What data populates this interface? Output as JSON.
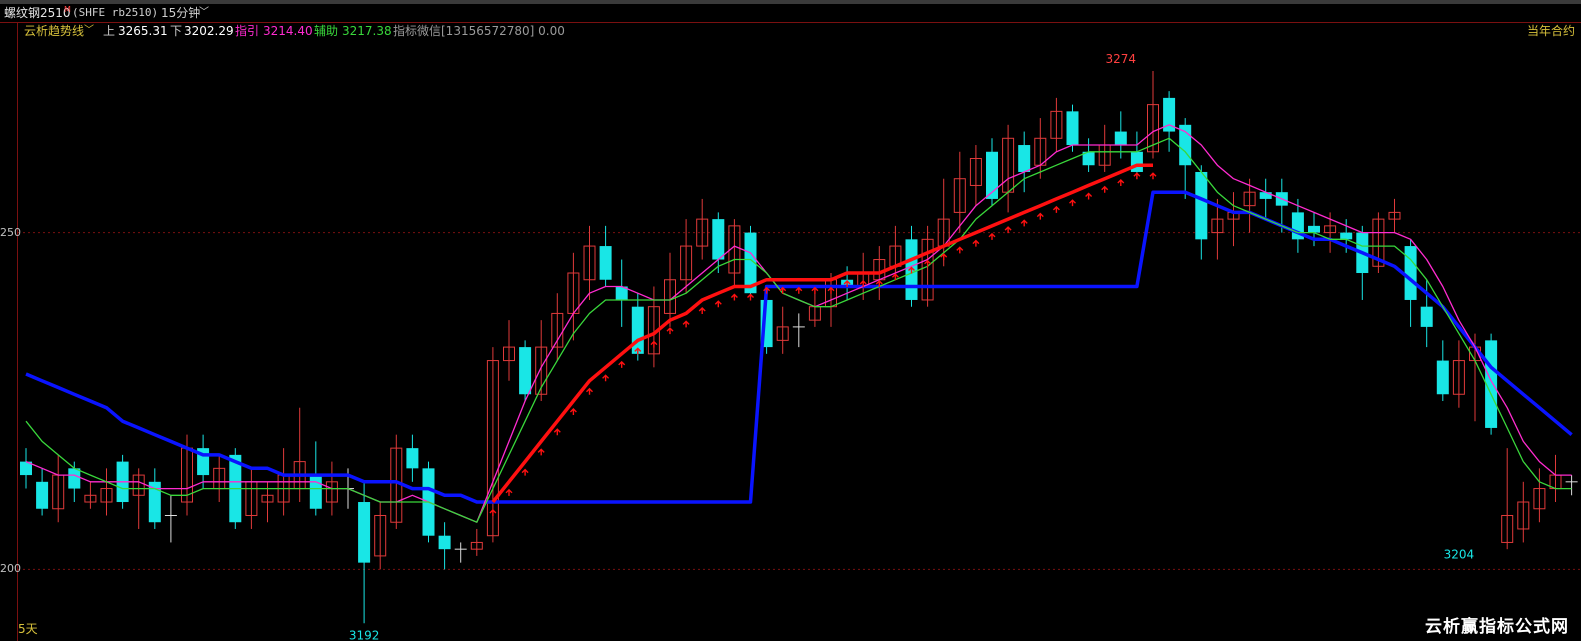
{
  "window": {
    "instrument_name": "螺纹钢2510",
    "instrument_flag": "M",
    "instrument_code": "(SHFE rb2510)",
    "period_label": "15分钟",
    "period_chevron": "﹀",
    "contract_label": "当年合约"
  },
  "indicator": {
    "name": "云析趋势线",
    "chevron": "﹀",
    "upper_key": "上",
    "upper_value": "3265.31",
    "lower_key": "下",
    "lower_value": "3202.29",
    "guide_key": "指引",
    "guide_value": "3214.40",
    "aux_key": "辅助",
    "aux_value": "3217.38",
    "wechat_text": "指标微信[13156572780] 0.00"
  },
  "footer": {
    "days_label": "5天",
    "watermark": "云析赢指标公式网"
  },
  "colors": {
    "up": "#e03a3a",
    "down": "#19e6e6",
    "blue_line": "#0a14ff",
    "red_line": "#ff1010",
    "magenta_line": "#ff2bd0",
    "green_line": "#39d83b",
    "grid": "#7a1010"
  },
  "chart_data": {
    "type": "candlestick",
    "title": "",
    "y_ticks": [
      {
        "value": 3250,
        "label": "250"
      },
      {
        "value": 3200,
        "label": "200"
      }
    ],
    "ylim": [
      3191,
      3278
    ],
    "annotations": [
      {
        "text": "3274",
        "value": 3274,
        "candle": 68
      },
      {
        "text": "3192",
        "value": 3192,
        "candle": 21
      },
      {
        "text": "3204",
        "value": 3204,
        "candle": 89
      }
    ],
    "candles": [
      [
        3216,
        3214,
        3218,
        3212
      ],
      [
        3213,
        3209,
        3215,
        3208
      ],
      [
        3209,
        3214,
        3217,
        3207
      ],
      [
        3215,
        3212,
        3216,
        3210
      ],
      [
        3210,
        3211,
        3213,
        3209
      ],
      [
        3210,
        3212,
        3215,
        3208
      ],
      [
        3216,
        3210,
        3217,
        3209
      ],
      [
        3211,
        3214,
        3215,
        3206
      ],
      [
        3213,
        3207,
        3215,
        3206
      ],
      [
        3208,
        3208,
        3211,
        3204
      ],
      [
        3210,
        3218,
        3220,
        3208
      ],
      [
        3218,
        3214,
        3220,
        3212
      ],
      [
        3212,
        3215,
        3217,
        3210
      ],
      [
        3217,
        3207,
        3218,
        3206
      ],
      [
        3208,
        3213,
        3215,
        3206
      ],
      [
        3210,
        3211,
        3213,
        3207
      ],
      [
        3210,
        3214,
        3218,
        3208
      ],
      [
        3212,
        3216,
        3224,
        3210
      ],
      [
        3214,
        3209,
        3219,
        3208
      ],
      [
        3210,
        3213,
        3216,
        3208
      ],
      [
        3212,
        3212,
        3215,
        3209
      ],
      [
        3210,
        3201,
        3213,
        3192
      ],
      [
        3202,
        3208,
        3210,
        3200
      ],
      [
        3207,
        3218,
        3220,
        3206
      ],
      [
        3218,
        3215,
        3220,
        3213
      ],
      [
        3215,
        3205,
        3216,
        3204
      ],
      [
        3205,
        3203,
        3207,
        3200
      ],
      [
        3203,
        3203,
        3204,
        3201
      ],
      [
        3203,
        3204,
        3206,
        3202
      ],
      [
        3205,
        3231,
        3233,
        3204
      ],
      [
        3231,
        3233,
        3237,
        3228
      ],
      [
        3233,
        3226,
        3234,
        3225
      ],
      [
        3226,
        3233,
        3237,
        3225
      ],
      [
        3233,
        3238,
        3241,
        3231
      ],
      [
        3238,
        3244,
        3247,
        3234
      ],
      [
        3243,
        3248,
        3251,
        3240
      ],
      [
        3248,
        3243,
        3251,
        3242
      ],
      [
        3242,
        3240,
        3246,
        3236
      ],
      [
        3239,
        3232,
        3241,
        3231
      ],
      [
        3232,
        3239,
        3242,
        3230
      ],
      [
        3238,
        3243,
        3247,
        3236
      ],
      [
        3243,
        3248,
        3252,
        3241
      ],
      [
        3248,
        3252,
        3255,
        3246
      ],
      [
        3252,
        3246,
        3253,
        3244
      ],
      [
        3244,
        3251,
        3252,
        3242
      ],
      [
        3250,
        3241,
        3251,
        3240
      ],
      [
        3240,
        3233,
        3242,
        3232
      ],
      [
        3234,
        3236,
        3239,
        3232
      ],
      [
        3236,
        3236,
        3238,
        3233
      ],
      [
        3237,
        3239,
        3241,
        3236
      ],
      [
        3239,
        3243,
        3244,
        3236
      ],
      [
        3243,
        3242,
        3245,
        3240
      ],
      [
        3242,
        3244,
        3247,
        3240
      ],
      [
        3243,
        3246,
        3248,
        3240
      ],
      [
        3245,
        3248,
        3251,
        3243
      ],
      [
        3249,
        3240,
        3251,
        3239
      ],
      [
        3240,
        3249,
        3251,
        3239
      ],
      [
        3248,
        3252,
        3258,
        3245
      ],
      [
        3253,
        3258,
        3262,
        3250
      ],
      [
        3257,
        3261,
        3263,
        3254
      ],
      [
        3262,
        3255,
        3264,
        3254
      ],
      [
        3256,
        3264,
        3266,
        3253
      ],
      [
        3263,
        3259,
        3265,
        3256
      ],
      [
        3260,
        3264,
        3267,
        3258
      ],
      [
        3264,
        3268,
        3270,
        3262
      ],
      [
        3268,
        3263,
        3269,
        3262
      ],
      [
        3262,
        3260,
        3264,
        3259
      ],
      [
        3260,
        3263,
        3266,
        3259
      ],
      [
        3265,
        3263,
        3268,
        3261
      ],
      [
        3262,
        3259,
        3265,
        3258
      ],
      [
        3262,
        3269,
        3274,
        3261
      ],
      [
        3270,
        3265,
        3271,
        3262
      ],
      [
        3266,
        3260,
        3267,
        3255
      ],
      [
        3259,
        3249,
        3260,
        3246
      ],
      [
        3250,
        3252,
        3255,
        3246
      ],
      [
        3252,
        3253,
        3256,
        3248
      ],
      [
        3254,
        3256,
        3258,
        3250
      ],
      [
        3256,
        3255,
        3258,
        3252
      ],
      [
        3256,
        3254,
        3258,
        3250
      ],
      [
        3253,
        3249,
        3255,
        3247
      ],
      [
        3251,
        3250,
        3253,
        3248
      ],
      [
        3250,
        3251,
        3253,
        3247
      ],
      [
        3250,
        3249,
        3252,
        3247
      ],
      [
        3250,
        3244,
        3251,
        3240
      ],
      [
        3245,
        3252,
        3253,
        3244
      ],
      [
        3252,
        3253,
        3255,
        3250
      ],
      [
        3248,
        3240,
        3249,
        3236
      ],
      [
        3239,
        3236,
        3243,
        3233
      ],
      [
        3231,
        3226,
        3234,
        3225
      ],
      [
        3226,
        3231,
        3234,
        3224
      ],
      [
        3231,
        3233,
        3235,
        3222
      ],
      [
        3234,
        3221,
        3235,
        3220
      ],
      [
        3204,
        3208,
        3218,
        3203
      ],
      [
        3206,
        3210,
        3213,
        3204
      ],
      [
        3209,
        3212,
        3215,
        3207
      ],
      [
        3212,
        3214,
        3217,
        3210
      ],
      [
        3213,
        3213,
        3214,
        3211
      ],
      [
        3214,
        3212,
        3215,
        3210
      ],
      [
        3212,
        3213,
        3214,
        3209
      ]
    ],
    "series": [
      {
        "name": "",
        "color": "#0a14ff",
        "values": [
          3229,
          3228,
          3227,
          3226,
          3225,
          3224,
          3222,
          3221,
          3220,
          3219,
          3218,
          3217,
          3217,
          3216,
          3215,
          3215,
          3214,
          3214,
          3214,
          3214,
          3214,
          3213,
          3213,
          3213,
          3212,
          3212,
          3211,
          3211,
          3210,
          3210,
          3210,
          3210,
          3210,
          3210,
          3210,
          3210,
          3210,
          3210,
          3210,
          3210,
          3210,
          3210,
          3210,
          3210,
          3210,
          3210,
          3242,
          3242,
          3242,
          3242,
          3242,
          3242,
          3242,
          3242,
          3242,
          3242,
          3242,
          3242,
          3242,
          3242,
          3242,
          3242,
          3242,
          3242,
          3242,
          3242,
          3242,
          3242,
          3242,
          3242,
          3256,
          3256,
          3256,
          3255,
          3254,
          3253,
          3253,
          3252,
          3251,
          3250,
          3249,
          3249,
          3248,
          3247,
          3246,
          3245,
          3243,
          3241,
          3239,
          3236,
          3233,
          3230,
          3228,
          3226,
          3224,
          3222,
          3220
        ]
      },
      {
        "name": "",
        "color": "#ff2bd0",
        "values": [
          3216,
          3215,
          3214,
          3214,
          3213,
          3213,
          3213,
          3213,
          3212,
          3212,
          3212,
          3213,
          3213,
          3213,
          3213,
          3213,
          3213,
          3213,
          3213,
          3212,
          3212,
          3211,
          3210,
          3210,
          3211,
          3210,
          3209,
          3208,
          3207,
          3213,
          3219,
          3225,
          3230,
          3234,
          3238,
          3241,
          3242,
          3242,
          3241,
          3240,
          3240,
          3242,
          3244,
          3246,
          3248,
          3247,
          3244,
          3241,
          3240,
          3239,
          3240,
          3241,
          3242,
          3243,
          3244,
          3245,
          3246,
          3248,
          3251,
          3254,
          3256,
          3258,
          3259,
          3260,
          3262,
          3263,
          3263,
          3263,
          3263,
          3263,
          3265,
          3266,
          3265,
          3263,
          3260,
          3258,
          3257,
          3256,
          3255,
          3254,
          3253,
          3252,
          3251,
          3250,
          3250,
          3250,
          3249,
          3246,
          3242,
          3237,
          3233,
          3228,
          3224,
          3219,
          3216,
          3214,
          3214
        ]
      },
      {
        "name": "",
        "color": "#39d83b",
        "values": [
          3222,
          3219,
          3217,
          3215,
          3214,
          3213,
          3212,
          3212,
          3212,
          3211,
          3211,
          3212,
          3212,
          3212,
          3212,
          3212,
          3212,
          3212,
          3212,
          3212,
          3212,
          3211,
          3210,
          3210,
          3210,
          3210,
          3209,
          3208,
          3207,
          3212,
          3217,
          3222,
          3227,
          3231,
          3235,
          3238,
          3240,
          3240,
          3240,
          3240,
          3240,
          3241,
          3243,
          3245,
          3246,
          3246,
          3244,
          3241,
          3240,
          3239,
          3239,
          3240,
          3241,
          3242,
          3243,
          3244,
          3245,
          3247,
          3249,
          3252,
          3254,
          3256,
          3258,
          3259,
          3260,
          3261,
          3262,
          3262,
          3262,
          3262,
          3263,
          3264,
          3262,
          3259,
          3256,
          3254,
          3253,
          3252,
          3251,
          3250,
          3250,
          3249,
          3249,
          3248,
          3248,
          3248,
          3246,
          3243,
          3239,
          3235,
          3231,
          3226,
          3221,
          3216,
          3213,
          3212,
          3212
        ]
      },
      {
        "name": "",
        "color": "#ff1010",
        "values": [
          null,
          null,
          null,
          null,
          null,
          null,
          null,
          null,
          null,
          null,
          null,
          null,
          null,
          null,
          null,
          null,
          null,
          null,
          null,
          null,
          null,
          null,
          null,
          null,
          null,
          null,
          null,
          null,
          null,
          3210,
          3213,
          3216,
          3219,
          3222,
          3225,
          3228,
          3230,
          3232,
          3234,
          3235,
          3237,
          3238,
          3240,
          3241,
          3242,
          3242,
          3243,
          3243,
          3243,
          3243,
          3243,
          3244,
          3244,
          3244,
          3245,
          3246,
          3247,
          3248,
          3249,
          3250,
          3251,
          3252,
          3253,
          3254,
          3255,
          3256,
          3257,
          3258,
          3259,
          3260,
          3260,
          null,
          null,
          null,
          null,
          null,
          null,
          null,
          null,
          null,
          null,
          null,
          null,
          null,
          null,
          null,
          null,
          null,
          null,
          null,
          null,
          null,
          null,
          null,
          null,
          null,
          null
        ]
      }
    ]
  }
}
